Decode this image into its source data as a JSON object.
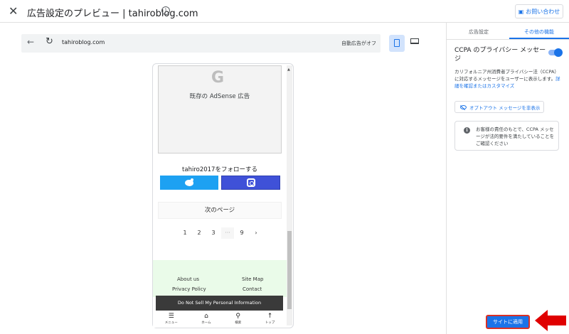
{
  "header": {
    "close_glyph": "✕",
    "title": "広告設定のプレビュー | tahiroblog.com",
    "info_glyph": "i",
    "contact_label": "お問い合わせ"
  },
  "browser": {
    "back_glyph": "←",
    "reload_glyph": "↻",
    "url": "tahiroblog.com",
    "auto_ads_status": "自動広告がオフ"
  },
  "preview": {
    "ad_placeholder_logo": "G",
    "ad_placeholder_text": "既存の AdSense 広告",
    "follow_text": "tahiro2017をフォローする",
    "next_page_label": "次のページ",
    "pagination": [
      "1",
      "2",
      "3",
      "···",
      "9",
      "›"
    ],
    "footer_links": {
      "about": "About us",
      "sitemap": "Site Map",
      "privacy": "Privacy Policy",
      "contact": "Contact"
    },
    "do_not_sell": "Do Not Sell My Personal Information",
    "mobile_nav": [
      {
        "glyph": "☰",
        "label": "メニュー"
      },
      {
        "glyph": "⌂",
        "label": "ホーム"
      },
      {
        "glyph": "⚲",
        "label": "検索"
      },
      {
        "glyph": "↑",
        "label": "トップ"
      }
    ]
  },
  "panel": {
    "tabs": [
      "広告設定",
      "その他の機能"
    ],
    "active_tab": "その他の機能",
    "ccpa_title": "CCPA のプライバシー メッセージ",
    "ccpa_enabled": true,
    "ccpa_desc": "カリフォルニア州消費者プライバシー法（CCPA）に対応するメッセージをユーザーに表示します。",
    "ccpa_link": "詳細を確認またはカスタマイズ",
    "optout_label": "オプトアウト メッセージを非表示",
    "note_glyph": "i",
    "note_text": "お客様の責任のもとで、CCPA メッセージが法的要件を満たしていることをご確認ください",
    "apply_label": "サイトに適用"
  },
  "colors": {
    "accent": "#1a73e8",
    "highlight": "#d93025"
  }
}
